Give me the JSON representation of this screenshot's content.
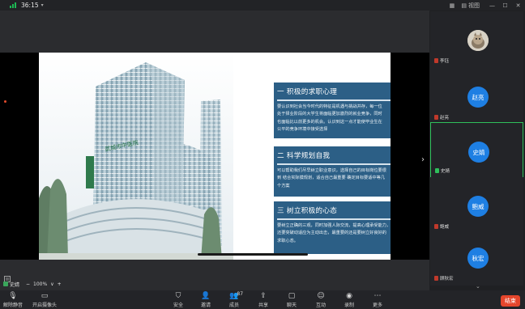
{
  "topbar": {
    "timer": "36:15",
    "view_label": "视图",
    "icons": [
      "signal-icon",
      "chevron-down-icon",
      "grid-icon",
      "view-icon",
      "minimize-icon",
      "maximize-icon",
      "close-icon"
    ]
  },
  "slide": {
    "boxes": [
      {
        "title": "一 积极的求职心理",
        "lines": [
          "要认识到社会当今时代的特征是机遇与挑战并存，每一位",
          "处于择业阶段的大学生将面临更加激烈的就业竞争，同时",
          "也面临比以前更多的机会。认识到这一点才能使毕业生在",
          "公平的竞争环境中接受选择"
        ]
      },
      {
        "title": "二 科学规划自我",
        "lines": [
          "可以帮助我们尽早树立职业意识，选择自己的目标岗位要很",
          "到 结合实际摸规划，适合自己最重要 确定目标要适中等几",
          "个方案"
        ]
      },
      {
        "title": "三 树立积极的心态",
        "lines": [
          "要树立正确的三观，同时加强人际交流，提高心理承受能力，",
          "还要突破动适应为主动出击，最重要的还是要树立好良好的",
          "求职心态。"
        ]
      }
    ],
    "building_sign": "武城市中医院",
    "colors": {
      "box_bg": "#2c5f86",
      "box_text": "#ffffff"
    }
  },
  "controls": {
    "presenter_name": "史婧",
    "zoom_minus": "−",
    "zoom_value": "100%",
    "zoom_chevron": "∨",
    "zoom_plus": "+"
  },
  "participants": [
    {
      "name": "李钰",
      "avatar_text": "",
      "mic": "muted",
      "active": false,
      "photo": true
    },
    {
      "name": "赵亮",
      "avatar_text": "赵亮",
      "mic": "muted",
      "active": false,
      "photo": false
    },
    {
      "name": "史婧",
      "avatar_text": "史婧",
      "mic": "on",
      "active": true,
      "photo": false
    },
    {
      "name": "鲍威",
      "avatar_text": "鲍威",
      "mic": "muted",
      "active": false,
      "photo": false
    },
    {
      "name": "顾秋宏",
      "avatar_text": "秋宏",
      "mic": "muted",
      "active": false,
      "photo": false
    }
  ],
  "toolbar": {
    "unmute": "解除静音",
    "camera": "开启摄像头",
    "security": "安全",
    "invite": "邀请",
    "members": "成员",
    "members_count": "87",
    "share": "共享",
    "chat": "聊天",
    "interact": "互动",
    "record": "录制",
    "more": "更多",
    "end": "结束"
  },
  "colors": {
    "accent_green": "#2fbf5b",
    "avatar_blue": "#1e7fe3",
    "end_red": "#e5462c"
  }
}
